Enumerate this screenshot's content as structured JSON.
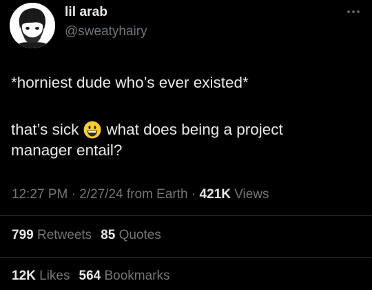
{
  "author": {
    "display_name": "lil arab",
    "handle": "@sweatyhairy"
  },
  "menu": {
    "more_icon": "more-horizontal-icon"
  },
  "tweet": {
    "line1": "*horniest dude who’s ever existed*",
    "line2_before_emoji": "that’s sick",
    "emoji": "grinning-face",
    "line2_after_emoji": "what does being a project",
    "line3": "manager entail?"
  },
  "meta": {
    "time": "12:27 PM",
    "sep1": "·",
    "date": "2/27/24",
    "source": "from Earth",
    "sep2": "·",
    "views_count": "421K",
    "views_label": "Views"
  },
  "stats": {
    "retweets_count": "799",
    "retweets_label": "Retweets",
    "quotes_count": "85",
    "quotes_label": "Quotes",
    "likes_count": "12K",
    "likes_label": "Likes",
    "bookmarks_count": "564",
    "bookmarks_label": "Bookmarks"
  },
  "colors": {
    "background": "#000000",
    "primary_text": "#e7e9ea",
    "secondary_text": "#71767b",
    "divider": "#2f3336",
    "emoji_yellow": "#ffcc33"
  }
}
